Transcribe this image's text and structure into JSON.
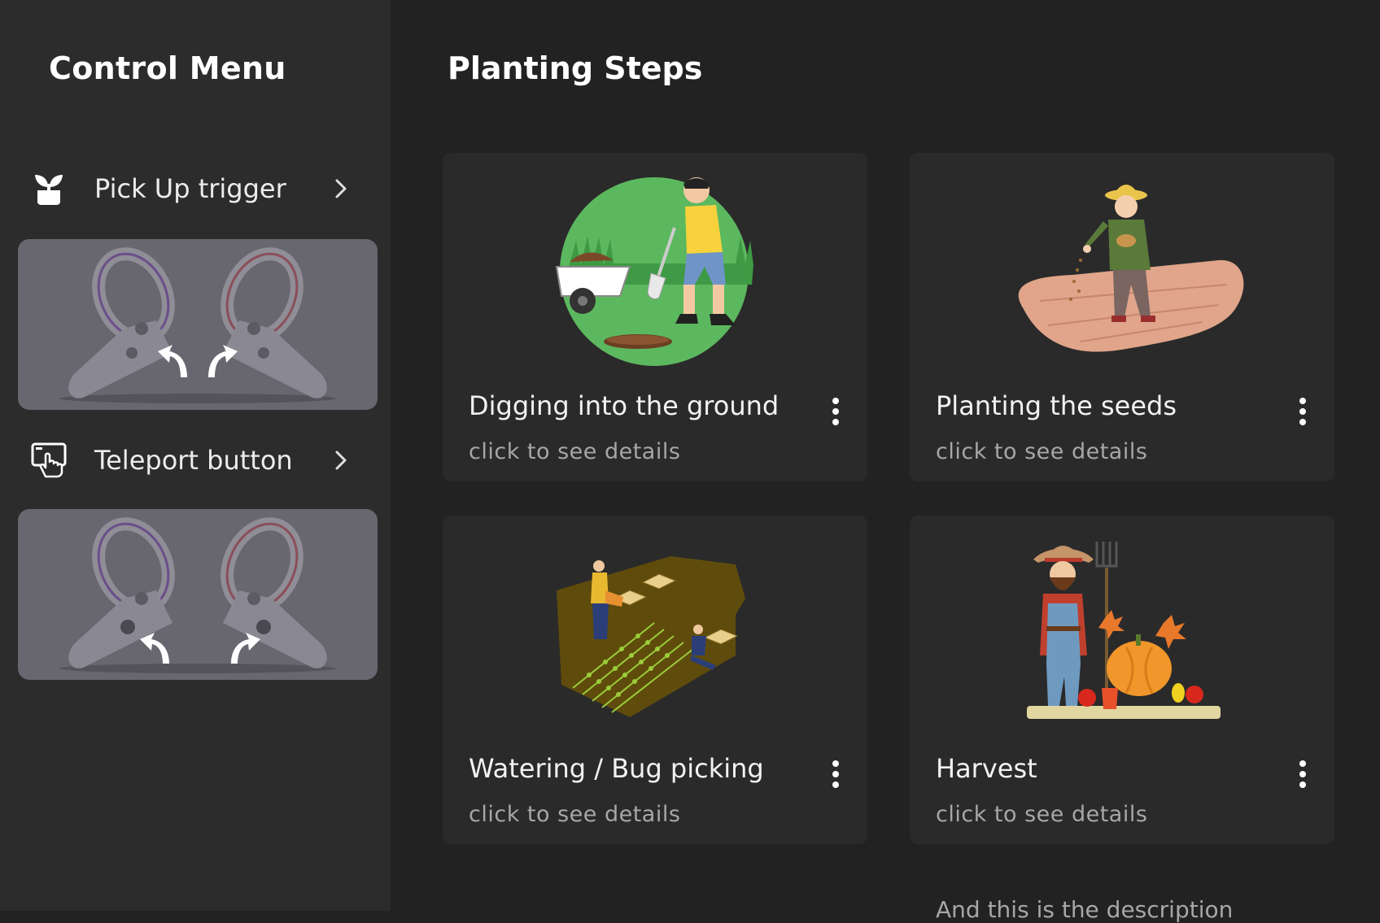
{
  "sidebar": {
    "title": "Control Menu",
    "items": [
      {
        "label": "Pick Up trigger",
        "icon": "plant-pot-icon"
      },
      {
        "label": "Teleport button",
        "icon": "touch-screen-icon"
      }
    ]
  },
  "main": {
    "title": "Planting Steps",
    "cards": [
      {
        "title": "Digging into the ground",
        "subtitle": "click to see details",
        "image": "digging-illustration"
      },
      {
        "title": "Planting the seeds",
        "subtitle": "click to see details",
        "image": "seeding-illustration"
      },
      {
        "title": "Watering / Bug picking",
        "subtitle": "click to see details",
        "image": "watering-illustration"
      },
      {
        "title": "Harvest",
        "subtitle": "click to see details",
        "image": "harvest-illustration"
      }
    ],
    "description_peek": "And this is the description"
  },
  "colors": {
    "background": "#222222",
    "sidebar": "#2c2c2c",
    "card": "#2a2a2a",
    "controller_panel": "#68666f",
    "subtitle": "#a7a7a7"
  }
}
